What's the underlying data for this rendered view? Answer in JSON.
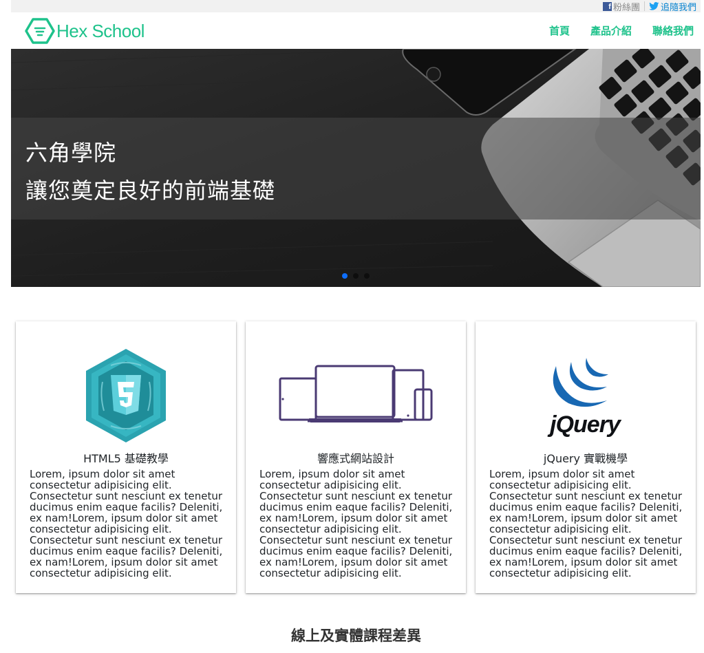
{
  "topbar": {
    "facebook_label": "粉絲團",
    "twitter_label": "追隨我們"
  },
  "navbar": {
    "brand": "Hex School",
    "links": [
      "首頁",
      "產品介紹",
      "聯絡我們"
    ]
  },
  "hero": {
    "line1": "六角學院",
    "line2": "讓您奠定良好的前端基礎",
    "slides": 3,
    "active_slide": 1
  },
  "cards": [
    {
      "icon": "html5-logo-icon",
      "title": "HTML5 基礎教學",
      "text": "Lorem, ipsum dolor sit amet consectetur adipisicing elit. Consectetur sunt nesciunt ex tenetur ducimus enim eaque facilis? Deleniti, ex nam!Lorem, ipsum dolor sit amet consectetur adipisicing elit. Consectetur sunt nesciunt ex tenetur ducimus enim eaque facilis? Deleniti, ex nam!Lorem, ipsum dolor sit amet consectetur adipisicing elit."
    },
    {
      "icon": "responsive-devices-icon",
      "title": "響應式網站設計",
      "text": "Lorem, ipsum dolor sit amet consectetur adipisicing elit. Consectetur sunt nesciunt ex tenetur ducimus enim eaque facilis? Deleniti, ex nam!Lorem, ipsum dolor sit amet consectetur adipisicing elit. Consectetur sunt nesciunt ex tenetur ducimus enim eaque facilis? Deleniti, ex nam!Lorem, ipsum dolor sit amet consectetur adipisicing elit."
    },
    {
      "icon": "jquery-logo-icon",
      "title": "jQuery 實戰機學",
      "text": "Lorem, ipsum dolor sit amet consectetur adipisicing elit. Consectetur sunt nesciunt ex tenetur ducimus enim eaque facilis? Deleniti, ex nam!Lorem, ipsum dolor sit amet consectetur adipisicing elit. Consectetur sunt nesciunt ex tenetur ducimus enim eaque facilis? Deleniti, ex nam!Lorem, ipsum dolor sit amet consectetur adipisicing elit."
    }
  ],
  "section": {
    "title": "線上及實體課程差異"
  },
  "colors": {
    "brand": "#1ec28b",
    "link": "#0a84d0",
    "carousel_active": "#0d6efd",
    "devices": "#4a3a73",
    "html5_teal": "#2ba3b0",
    "jquery_blue": "#1868b3"
  }
}
